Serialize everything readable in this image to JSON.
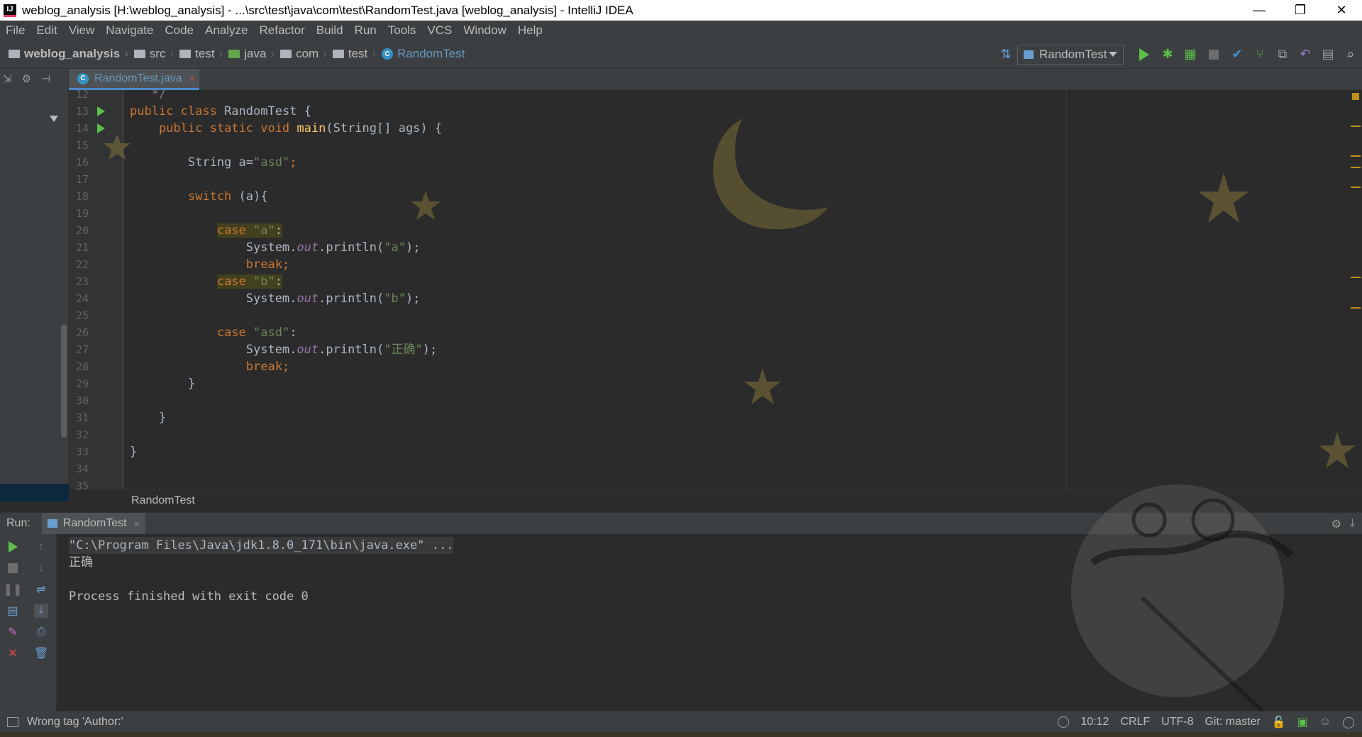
{
  "window": {
    "title": "weblog_analysis [H:\\weblog_analysis] - ...\\src\\test\\java\\com\\test\\RandomTest.java [weblog_analysis] - IntelliJ IDEA",
    "app_icon": "IJ",
    "minimize_glyph": "—",
    "restore_glyph": "❐",
    "close_glyph": "✕"
  },
  "menu": [
    "File",
    "Edit",
    "View",
    "Navigate",
    "Code",
    "Analyze",
    "Refactor",
    "Build",
    "Run",
    "Tools",
    "VCS",
    "Window",
    "Help"
  ],
  "breadcrumbs": {
    "project": "weblog_analysis",
    "folders": [
      "src",
      "test",
      "java",
      "com",
      "test"
    ],
    "class_name": "RandomTest",
    "separator": "›"
  },
  "run_config": {
    "label": "RandomTest"
  },
  "toolbar_icons": [
    "build-icon",
    "run-icon",
    "debug-icon",
    "coverage-icon",
    "stop-icon",
    "vcs-update-icon",
    "vcs-commit-icon",
    "vcs-compare-icon",
    "undo-icon",
    "project-structure-icon",
    "search-icon"
  ],
  "left_tools": {
    "collapse": "⇲",
    "settings": "⚙",
    "hide": "⊣"
  },
  "editor": {
    "tab_label": "RandomTest.java",
    "tab_close": "×",
    "method_breadcrumb": "RandomTest",
    "lines": [
      {
        "n": "12",
        "tokens": [
          {
            "t": "   */",
            "c": "cmt"
          }
        ]
      },
      {
        "n": "13",
        "run": true,
        "tokens": [
          {
            "t": "public class ",
            "c": "kw"
          },
          {
            "t": "RandomTest {",
            "c": "plain"
          }
        ]
      },
      {
        "n": "14",
        "run": true,
        "tokens": [
          {
            "t": "    public static void ",
            "c": "kw"
          },
          {
            "t": "main",
            "c": "fn"
          },
          {
            "t": "(String[] ags) {",
            "c": "plain"
          }
        ]
      },
      {
        "n": "15",
        "tokens": []
      },
      {
        "n": "16",
        "tokens": [
          {
            "t": "        String a=",
            "c": "plain"
          },
          {
            "t": "\"asd\"",
            "c": "str"
          },
          {
            "t": ";",
            "c": "kw"
          }
        ]
      },
      {
        "n": "17",
        "tokens": []
      },
      {
        "n": "18",
        "tokens": [
          {
            "t": "        switch ",
            "c": "kw"
          },
          {
            "t": "(a){",
            "c": "plain"
          }
        ]
      },
      {
        "n": "19",
        "tokens": []
      },
      {
        "n": "20",
        "tokens": [
          {
            "t": "            ",
            "c": "plain"
          },
          {
            "t": "case ",
            "c": "kw hl"
          },
          {
            "t": "\"a\"",
            "c": "str hl"
          },
          {
            "t": ":",
            "c": "plain hl"
          }
        ]
      },
      {
        "n": "21",
        "tokens": [
          {
            "t": "                System.",
            "c": "plain"
          },
          {
            "t": "out",
            "c": "fld"
          },
          {
            "t": ".println(",
            "c": "plain"
          },
          {
            "t": "\"a\"",
            "c": "str"
          },
          {
            "t": ");",
            "c": "plain"
          }
        ]
      },
      {
        "n": "22",
        "tokens": [
          {
            "t": "                break;",
            "c": "kw"
          }
        ]
      },
      {
        "n": "23",
        "tokens": [
          {
            "t": "            ",
            "c": "plain"
          },
          {
            "t": "case ",
            "c": "kw hl"
          },
          {
            "t": "\"b\"",
            "c": "str hl"
          },
          {
            "t": ":",
            "c": "plain hl"
          }
        ]
      },
      {
        "n": "24",
        "tokens": [
          {
            "t": "                System.",
            "c": "plain"
          },
          {
            "t": "out",
            "c": "fld"
          },
          {
            "t": ".println(",
            "c": "plain"
          },
          {
            "t": "\"b\"",
            "c": "str"
          },
          {
            "t": ");",
            "c": "plain"
          }
        ]
      },
      {
        "n": "25",
        "tokens": []
      },
      {
        "n": "26",
        "tokens": [
          {
            "t": "            case ",
            "c": "kw"
          },
          {
            "t": "\"asd\"",
            "c": "str"
          },
          {
            "t": ":",
            "c": "plain"
          }
        ]
      },
      {
        "n": "27",
        "tokens": [
          {
            "t": "                System.",
            "c": "plain"
          },
          {
            "t": "out",
            "c": "fld"
          },
          {
            "t": ".println(",
            "c": "plain"
          },
          {
            "t": "\"正确\"",
            "c": "str"
          },
          {
            "t": ");",
            "c": "plain"
          }
        ]
      },
      {
        "n": "28",
        "tokens": [
          {
            "t": "                break;",
            "c": "kw"
          }
        ]
      },
      {
        "n": "29",
        "tokens": [
          {
            "t": "        }",
            "c": "plain"
          }
        ]
      },
      {
        "n": "30",
        "tokens": []
      },
      {
        "n": "31",
        "tokens": [
          {
            "t": "    }",
            "c": "plain"
          }
        ]
      },
      {
        "n": "32",
        "tokens": []
      },
      {
        "n": "33",
        "tokens": [
          {
            "t": "}",
            "c": "plain"
          }
        ]
      },
      {
        "n": "34",
        "tokens": []
      },
      {
        "n": "35",
        "tokens": []
      }
    ]
  },
  "run_panel": {
    "label": "Run:",
    "tab_label": "RandomTest",
    "tab_close": "×",
    "console": [
      {
        "text": "\"C:\\Program Files\\Java\\jdk1.8.0_171\\bin\\java.exe\" ...",
        "kind": "cmdline"
      },
      {
        "text": "正确",
        "kind": "out"
      },
      {
        "text": "",
        "kind": "out"
      },
      {
        "text": "Process finished with exit code 0",
        "kind": "out"
      }
    ],
    "settings_glyph": "⚙",
    "hide_glyph": "⤓"
  },
  "status": {
    "message": "Wrong tag 'Author:'",
    "position": "10:12",
    "line_sep": "CRLF",
    "encoding": "UTF-8",
    "git": "Git: master"
  },
  "colors": {
    "keyword": "#cc7832",
    "string": "#6a8759",
    "method": "#ffc66d",
    "field": "#9876aa",
    "run_green": "#5bbf4a",
    "stop_red": "#e5484d"
  }
}
